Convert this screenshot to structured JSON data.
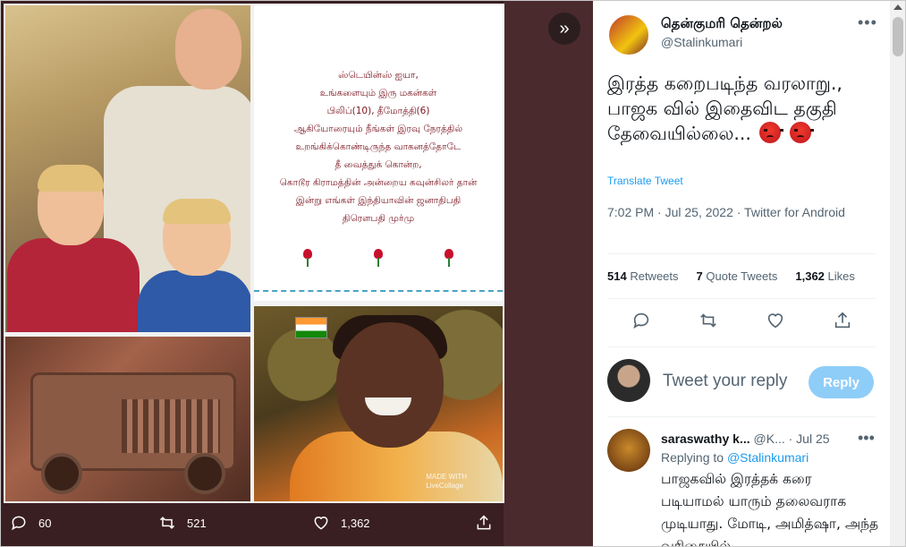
{
  "media_panel": {
    "collage_text": {
      "lines": [
        "ஸ்டெயின்ஸ் ஐயா,",
        "உங்களையும் இரு மகன்கள்",
        "பிலிப்(10), தீமோத்தி(6)",
        "ஆகியோரையும் நீங்கள் இரவு நேரத்தில்",
        "உறங்கிக்கொண்டிருந்த வாகனத்தோடே",
        "தீ வைத்துக் கொன்ற,",
        "கொடூர கிராமத்தின் அன்றைய கவுன்சிலர் தான்",
        "இன்று எங்கள் இந்தியாவின் ஜனாதிபதி",
        "திரௌபதி முர்மு"
      ]
    },
    "watermark": [
      "MADE WITH",
      "LiveCollage"
    ],
    "actions": {
      "reply_count": "60",
      "retweet_count": "521",
      "like_count": "1,362"
    }
  },
  "tweet": {
    "display_name": "தென்குமரி தென்றல்",
    "handle": "@Stalinkumari",
    "text": "இரத்த கறைபடிந்த வரலாறு., பாஜக வில் இதைவிட தகுதி தேவையில்லை...",
    "emoji": "angry-face-icon",
    "translate_label": "Translate Tweet",
    "timestamp": "7:02 PM · Jul 25, 2022 · Twitter for Android",
    "stats": {
      "retweets": "514",
      "retweets_label": "Retweets",
      "quote_tweets": "7",
      "quote_tweets_label": "Quote Tweets",
      "likes": "1,362",
      "likes_label": "Likes"
    }
  },
  "reply_box": {
    "placeholder": "Tweet your reply",
    "button_label": "Reply"
  },
  "reply": {
    "name": "saraswathy k...",
    "handle": "@K...",
    "date": "· Jul 25",
    "replying_prefix": "Replying to",
    "replying_to": "@Stalinkumari",
    "text": "பாஜகவில் இரத்தக் கரை படியாமல் யாரும் தலைவராக முடியாது. மோடி, அமித்ஷா, அந்த வரிசையில்"
  },
  "colors": {
    "accent": "#1d9bf0",
    "reply_button": "#8ecdf8",
    "overlay": "#3a1f22"
  }
}
